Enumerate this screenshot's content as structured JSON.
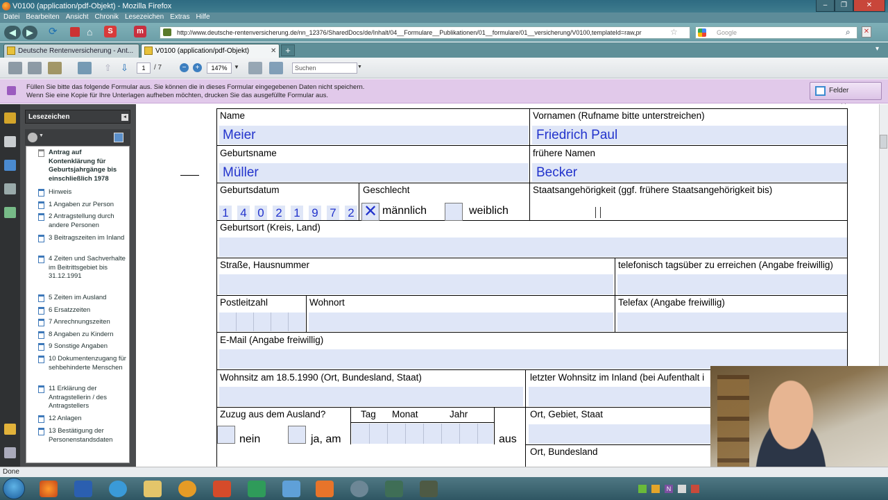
{
  "window": {
    "title": "V0100 (application/pdf-Objekt) - Mozilla Firefox",
    "controls": [
      "‒",
      "❐",
      "✕"
    ]
  },
  "menubar": [
    "Datei",
    "Bearbeiten",
    "Ansicht",
    "Chronik",
    "Lesezeichen",
    "Extras",
    "Hilfe"
  ],
  "navbar": {
    "url": "http://www.deutsche-rentenversicherung.de/nn_12376/SharedDocs/de/Inhalt/04__Formulare__Publikationen/01__formulare/01__versicherung/V0100,templateId=raw,pr",
    "search_placeholder": "Google"
  },
  "tabs": [
    {
      "label": "Deutsche Rentenversicherung - Ant...",
      "active": false
    },
    {
      "label": "V0100 (application/pdf-Objekt)",
      "active": true
    }
  ],
  "new_tab": "+",
  "pdf_toolbar": {
    "page": "1",
    "page_count": "/ 7",
    "zoom": "147%",
    "search_placeholder": "Suchen"
  },
  "notice": {
    "line1": "Füllen Sie bitte das folgende Formular aus. Sie können die in dieses Formular eingegebenen Daten nicht speichern.",
    "line2": "Wenn Sie eine Kopie für Ihre Unterlagen aufheben möchten, drucken Sie das ausgefüllte Formular aus.",
    "button": "Felder markieren"
  },
  "bookmarks": {
    "title": "Lesezeichen",
    "items": [
      "Antrag auf Kontenklärung für Geburtsjahrgänge bis einschließlich 1978",
      "Hinweis",
      "1 Angaben zur Person",
      "2 Antragstellung durch andere Personen",
      "3 Beitragszeiten im Inland",
      "4 Zeiten und Sachverhalte im Beitrittsgebiet bis 31.12.1991",
      "5 Zeiten im Ausland",
      "6 Ersatzzeiten",
      "7 Anrechnungszeiten",
      "8 Angaben zu Kindern",
      "9 Sonstige Angaben",
      "10 Dokumentenzugang für sehbehinderte Menschen",
      "11 Erklärung der Antragstellerin / des Antragstellers",
      "12 Anlagen",
      "13 Bestätigung der Personenstandsdaten"
    ]
  },
  "form": {
    "name_label": "Name",
    "name_value": "Meier",
    "vornamen_label": "Vornamen (Rufname bitte unterstreichen)",
    "vornamen_value": "Friedrich Paul",
    "geburtsname_label": "Geburtsname",
    "geburtsname_value": "Müller",
    "fruehere_namen_label": "frühere Namen",
    "fruehere_namen_value": "Becker",
    "geburtsdatum_label": "Geburtsdatum",
    "geburtsdatum_digits": [
      "1",
      "4",
      "0",
      "2",
      "1",
      "9",
      "7",
      "2"
    ],
    "geschlecht_label": "Geschlecht",
    "maennlich_label": "männlich",
    "weiblich_label": "weiblich",
    "maennlich_checked": true,
    "weiblich_checked": false,
    "staat_label": "Staatsangehörigkeit (ggf. frühere Staatsangehörigkeit bis)",
    "geburtsort_label": "Geburtsort (Kreis, Land)",
    "strasse_label": "Straße, Hausnummer",
    "telefon_label": "telefonisch tagsüber zu erreichen (Angabe freiwillig)",
    "plz_label": "Postleitzahl",
    "wohnort_label": "Wohnort",
    "telefax_label": "Telefax (Angabe freiwillig)",
    "email_label": "E-Mail (Angabe freiwillig)",
    "wohnsitz1990_label": "Wohnsitz am 18.5.1990 (Ort, Bundesland, Staat)",
    "letzter_wohnsitz_label": "letzter Wohnsitz im Inland (bei Aufenthalt i",
    "zuzug_label": "Zuzug aus dem Ausland?",
    "tag_label": "Tag",
    "monat_label": "Monat",
    "jahr_label": "Jahr",
    "nein_label": "nein",
    "ja_am_label": "ja, am",
    "aus_label": "aus",
    "ort_gebiet_label": "Ort, Gebiet, Staat",
    "ort_bundesland_label": "Ort, Bundesland"
  },
  "status": "Done",
  "colors": {
    "field_fill": "#dfe6f7",
    "field_text": "#2233cc",
    "notice_bg": "#e1c9ea"
  }
}
